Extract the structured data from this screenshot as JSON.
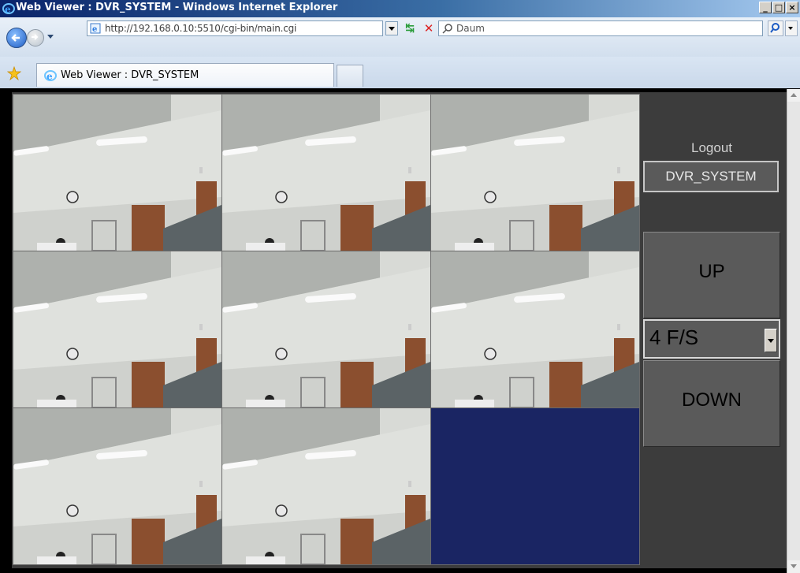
{
  "window": {
    "title": "Web Viewer : DVR_SYSTEM - Windows Internet Explorer",
    "controls": [
      "_",
      "□",
      "×"
    ]
  },
  "address_bar": {
    "url": "http://192.168.0.10:5510/cgi-bin/main.cgi",
    "search_text": "Daum"
  },
  "tabs": [
    {
      "label": "Web Viewer : DVR_SYSTEM",
      "active": true
    }
  ],
  "panel": {
    "logout_label": "Logout",
    "system_name": "DVR_SYSTEM",
    "up_label": "UP",
    "fps_value": "4 F/S",
    "down_label": "DOWN"
  },
  "cameras": {
    "count_visible": 8,
    "empty_slot_color": "#1a2563"
  },
  "colors": {
    "titlebar": "#0a246a",
    "panel_bg": "#3c3c3c",
    "button_bg": "#5a5a5a"
  },
  "icons": [
    "ie-logo-icon",
    "back-arrow-icon",
    "forward-arrow-icon",
    "page-icon",
    "refresh-icon",
    "stop-icon",
    "search-icon",
    "favorites-star-icon"
  ]
}
